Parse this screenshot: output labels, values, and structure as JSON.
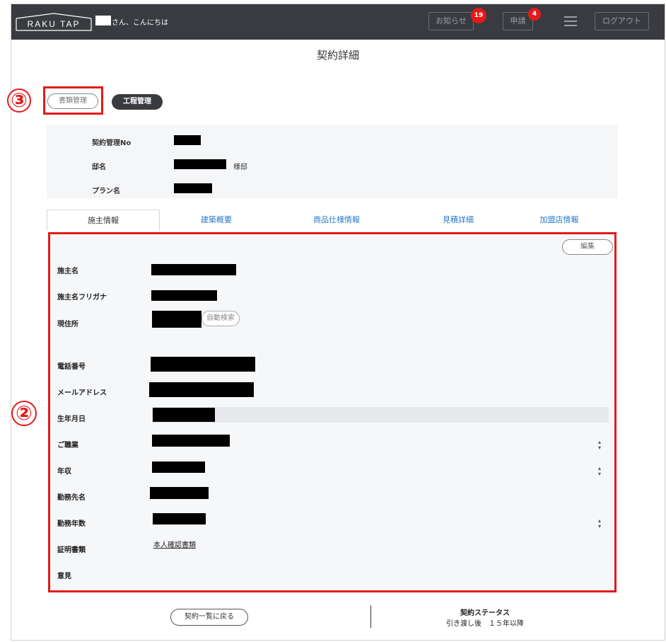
{
  "header": {
    "logo": "RAKU TAP",
    "greeting": "さん、こんにちは",
    "notice_label": "お知らせ",
    "notice_count": "19",
    "request_label": "申請",
    "request_count": "4",
    "logout_label": "ログアウト"
  },
  "page": {
    "title": "契約詳細"
  },
  "actions": {
    "documents": "書類管理",
    "process": "工程管理"
  },
  "summary": {
    "contract_no_label": "契約管理No",
    "house_label": "邸名",
    "house_suffix": "様邸",
    "plan_label": "プラン名"
  },
  "tabs": [
    "施主情報",
    "建築概要",
    "商品仕様情報",
    "見積詳細",
    "加盟店情報"
  ],
  "owner": {
    "edit": "編集",
    "name": "施主名",
    "kana": "施主名フリガナ",
    "address": "現住所",
    "auto_search": "自動検索",
    "phone": "電話番号",
    "email": "メールアドレス",
    "birthday": "生年月日",
    "occupation": "ご職業",
    "income": "年収",
    "employer": "勤務先名",
    "years": "勤務年数",
    "proof_docs": "証明書類",
    "proof_link": "本人確認書類",
    "opinion": "意見"
  },
  "footer": {
    "back": "契約一覧に戻る",
    "status_title": "契約ステータス",
    "status_value": "引き渡し後　１５年以降"
  },
  "annotations": {
    "box2": "②",
    "box3": "③"
  },
  "colors": {
    "header_bg": "#393b40",
    "badge": "#e41a1a",
    "link": "#2a78c8",
    "annotation": "#e41a1a"
  }
}
